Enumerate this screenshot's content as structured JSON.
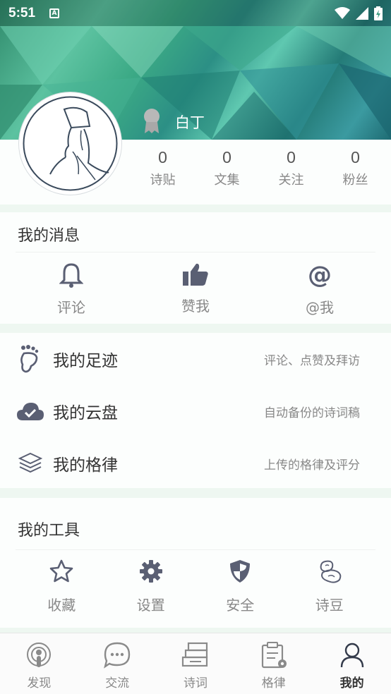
{
  "status_bar": {
    "time": "5:51",
    "a_badge": "A"
  },
  "profile": {
    "username": "白丁"
  },
  "stats": [
    {
      "value": "0",
      "label": "诗贴"
    },
    {
      "value": "0",
      "label": "文集"
    },
    {
      "value": "0",
      "label": "关注"
    },
    {
      "value": "0",
      "label": "粉丝"
    }
  ],
  "messages": {
    "title": "我的消息",
    "items": [
      {
        "label": "评论",
        "icon": "bell-icon"
      },
      {
        "label": "赞我",
        "icon": "thumbs-up-icon"
      },
      {
        "label": "@我",
        "icon": "at-icon"
      }
    ]
  },
  "list": [
    {
      "title": "我的足迹",
      "desc": "评论、点赞及拜访",
      "icon": "footprint-icon"
    },
    {
      "title": "我的云盘",
      "desc": "自动备份的诗词稿",
      "icon": "cloud-check-icon"
    },
    {
      "title": "我的格律",
      "desc": "上传的格律及评分",
      "icon": "layers-icon"
    }
  ],
  "tools": {
    "title": "我的工具",
    "items": [
      {
        "label": "收藏",
        "icon": "star-icon"
      },
      {
        "label": "设置",
        "icon": "gear-icon"
      },
      {
        "label": "安全",
        "icon": "shield-icon"
      },
      {
        "label": "诗豆",
        "icon": "bean-icon"
      }
    ]
  },
  "tabs": [
    {
      "label": "发现",
      "icon": "podcast-icon"
    },
    {
      "label": "交流",
      "icon": "chat-icon"
    },
    {
      "label": "诗词",
      "icon": "books-icon"
    },
    {
      "label": "格律",
      "icon": "clipboard-gear-icon"
    },
    {
      "label": "我的",
      "icon": "person-icon",
      "active": true
    }
  ],
  "colors": {
    "icon": "#5a5f73",
    "accent": "#2f9b7f"
  }
}
